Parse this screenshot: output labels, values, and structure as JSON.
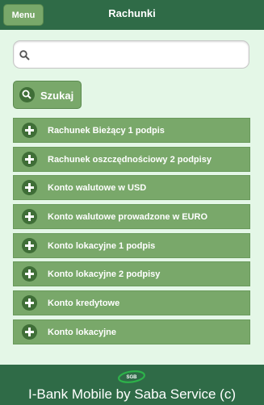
{
  "header": {
    "menu_label": "Menu",
    "title": "Rachunki"
  },
  "search": {
    "placeholder": "",
    "value": "",
    "button_label": "Szukaj"
  },
  "accounts": [
    {
      "label": "Rachunek Bieżący 1 podpis"
    },
    {
      "label": "Rachunek oszczędnościowy 2 podpisy"
    },
    {
      "label": "Konto walutowe w USD"
    },
    {
      "label": "Konto walutowe prowadzone w EURO"
    },
    {
      "label": "Konto lokacyjne 1 podpis"
    },
    {
      "label": "Konto lokacyjne 2 podpisy"
    },
    {
      "label": "Konto kredytowe"
    },
    {
      "label": "Konto lokacyjne"
    }
  ],
  "footer": {
    "logo_text": "SGB",
    "text": "I-Bank Mobile by Saba Service (c)"
  },
  "colors": {
    "header_bg": "#2f6b47",
    "button_bg": "#79a86a",
    "icon_bg": "#3f6e37",
    "page_bg": "#e4f7e7"
  },
  "icons": {
    "search": "search-icon",
    "item": "plus-icon",
    "logo": "sgb-logo"
  }
}
